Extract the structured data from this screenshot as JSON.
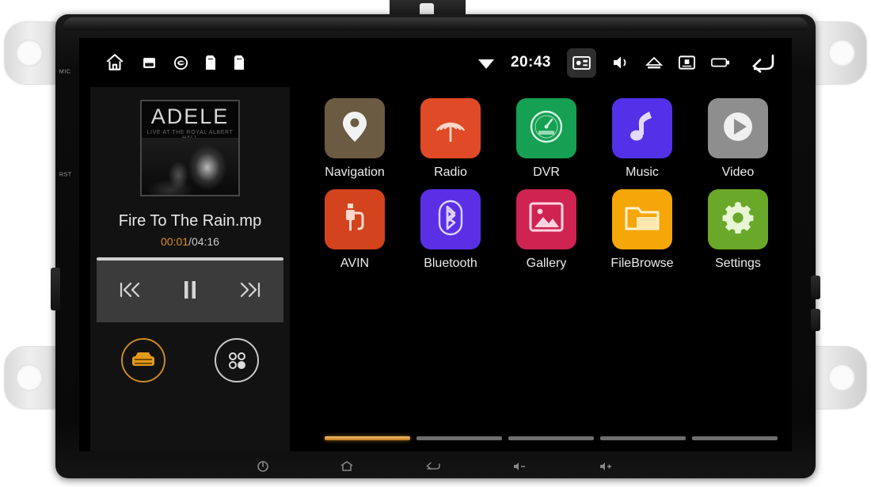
{
  "device": {
    "bezel_labels": [
      "MIC",
      "RST"
    ],
    "brackets": [
      "mount-bracket-left-top",
      "mount-bracket-left-bottom",
      "mount-bracket-right-top",
      "mount-bracket-right-bottom"
    ]
  },
  "status_bar": {
    "left_icons": [
      {
        "name": "home-icon"
      },
      {
        "name": "sd-card-icon"
      },
      {
        "name": "gps-target-icon"
      },
      {
        "name": "sim-card-1-icon"
      },
      {
        "name": "sim-card-2-icon"
      }
    ],
    "wifi_icon": "wifi-icon",
    "clock": "20:43",
    "screenshot_icon": "screenshot-icon",
    "volume_icon": "volume-icon",
    "eject_icon": "eject-icon",
    "screen_off_icon": "screen-off-icon",
    "battery_icon": "battery-icon",
    "back_icon": "back-arrow-icon"
  },
  "music_widget": {
    "album_art_title": "ADELE",
    "album_art_subtitle": "LIVE AT THE ROYAL ALBERT HALL",
    "track_title": "Fire To The Rain.mp",
    "elapsed": "00:01",
    "separator": "/",
    "duration": "04:16",
    "controls": [
      {
        "name": "previous-track-button",
        "glyph": "prev"
      },
      {
        "name": "pause-button",
        "glyph": "pause"
      },
      {
        "name": "next-track-button",
        "glyph": "next"
      }
    ],
    "shortcut_car": "car-mode-button",
    "shortcut_apps": "all-apps-button",
    "accent_color": "#d98f1f"
  },
  "app_grid": {
    "rows": [
      [
        {
          "label": "Navigation",
          "icon": "location-pin-icon",
          "tile_color": "#6b5b43",
          "icon_color": "#f2f2f2"
        },
        {
          "label": "Radio",
          "icon": "radio-waves-icon",
          "tile_color": "#e04a26",
          "icon_color": "#ffd8cc"
        },
        {
          "label": "DVR",
          "icon": "gauge-icon",
          "tile_color": "#16a053",
          "icon_color": "#d8f5e4"
        },
        {
          "label": "Music",
          "icon": "music-note-icon",
          "tile_color": "#5331e8",
          "icon_color": "#e2dbff"
        },
        {
          "label": "Video",
          "icon": "play-circle-icon",
          "tile_color": "#8e8e8e",
          "icon_color": "#f0f0f0"
        }
      ],
      [
        {
          "label": "AVIN",
          "icon": "av-plug-icon",
          "tile_color": "#d2431e",
          "icon_color": "#ffd9cd"
        },
        {
          "label": "Bluetooth",
          "icon": "bluetooth-icon",
          "tile_color": "#5b2fe6",
          "icon_color": "#ddd3ff"
        },
        {
          "label": "Gallery",
          "icon": "photo-icon",
          "tile_color": "#cf2352",
          "icon_color": "#ffd3e0"
        },
        {
          "label": "FileBrowse",
          "icon": "folder-icon",
          "tile_color": "#f5a609",
          "icon_color": "#fff2d0"
        },
        {
          "label": "Settings",
          "icon": "gear-icon",
          "tile_color": "#69a828",
          "icon_color": "#e7f5d5"
        }
      ]
    ],
    "pages": 5,
    "active_page": 1
  },
  "hardware_nav": [
    {
      "name": "power-button",
      "glyph": "power"
    },
    {
      "name": "home-button",
      "glyph": "home"
    },
    {
      "name": "back-button",
      "glyph": "back"
    },
    {
      "name": "volume-down-button",
      "glyph": "voldown"
    },
    {
      "name": "volume-up-button",
      "glyph": "volup"
    }
  ]
}
